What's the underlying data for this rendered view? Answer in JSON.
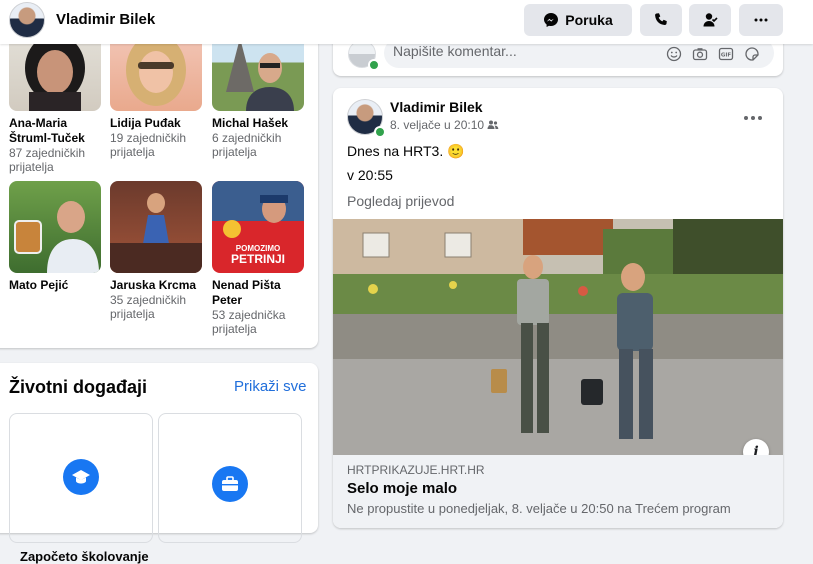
{
  "header": {
    "profile_name": "Vladimir Bilek",
    "message_label": "Poruka",
    "icons": [
      "messenger-icon",
      "phone-icon",
      "friend-icon",
      "more-icon"
    ]
  },
  "friends": [
    {
      "name": "Ana-Maria Štruml-Tuček",
      "mutual": "87 zajedničkih prijatelja"
    },
    {
      "name": "Lidija Puđak",
      "mutual": "19 zajedničkih prijatelja"
    },
    {
      "name": "Michal Hašek",
      "mutual": "6 zajedničkih prijatelja"
    },
    {
      "name": "Mato Pejić",
      "mutual": ""
    },
    {
      "name": "Jaruska Krcma",
      "mutual": "35 zajedničkih prijatelja"
    },
    {
      "name": "Nenad Pišta Peter",
      "mutual": "53 zajednička prijatelja"
    }
  ],
  "friend_photo_texts": {
    "petrinja_1": "POMOZIMO",
    "petrinja_2": "PETRINJI"
  },
  "life_events": {
    "title": "Životni događaji",
    "see_all": "Prikaži sve",
    "tile_label": "Započeto školovanje"
  },
  "comment_box": {
    "placeholder": "Napišite komentar..."
  },
  "post": {
    "author": "Vladimir Bilek",
    "date": "8. veljače u 20:10 ·",
    "text_line1": "Dnes na HRT3. 🙂",
    "text_line2": "v 20:55",
    "translate": "Pogledaj prijevod",
    "info_glyph": "i",
    "link": {
      "domain": "HRTPRIKAZUJE.HRT.HR",
      "title": "Selo moje malo",
      "description": "Ne propustite u ponedjeljak, 8. veljače u 20:50 na Trećem program"
    }
  },
  "colors": {
    "accent": "#1877f2",
    "link": "#216fdb",
    "online": "#31a24c"
  }
}
